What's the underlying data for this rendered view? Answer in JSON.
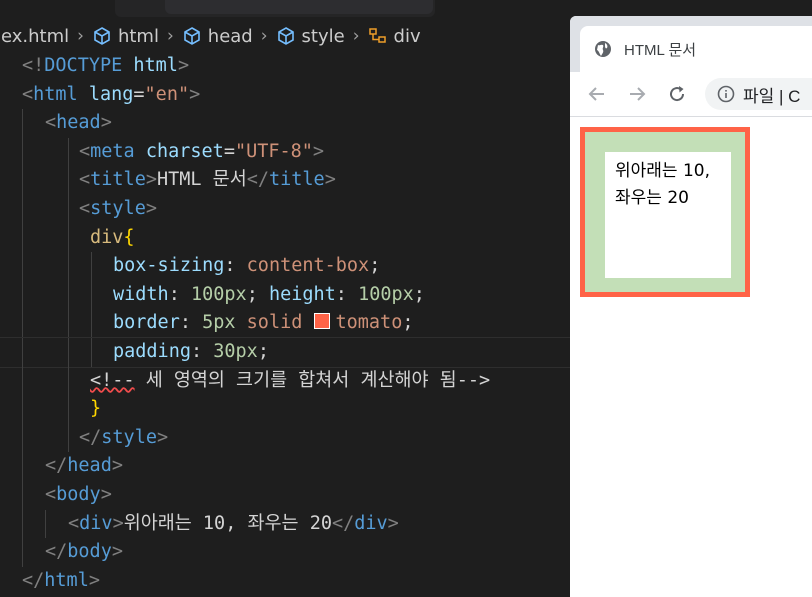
{
  "breadcrumb": {
    "items": [
      {
        "label": "lex.html",
        "icon": "file"
      },
      {
        "label": "html",
        "icon": "cube-icon"
      },
      {
        "label": "head",
        "icon": "cube-icon"
      },
      {
        "label": "style",
        "icon": "cube-icon"
      },
      {
        "label": "div",
        "icon": "css-selector-icon"
      }
    ]
  },
  "code": {
    "l1": {
      "a": "<!",
      "b": "DOCTYPE",
      "c": " html",
      "d": ">"
    },
    "l2": {
      "a": "<",
      "b": "html",
      "c": " lang",
      "d": "=",
      "e": "\"en\"",
      "f": ">"
    },
    "l3": {
      "a": "<",
      "b": "head",
      "c": ">"
    },
    "l4": {
      "a": "<",
      "b": "meta",
      "c": " charset",
      "d": "=",
      "e": "\"UTF-8\"",
      "f": ">"
    },
    "l5": {
      "a": "<",
      "b": "title",
      "c": ">",
      "d": "HTML 문서",
      "e": "</",
      "f": "title",
      "g": ">"
    },
    "l6": {
      "a": "<",
      "b": "style",
      "c": ">"
    },
    "l7": {
      "a": "div",
      "b": "{"
    },
    "l8": {
      "a": "box-sizing",
      "b": ": ",
      "c": "content-box",
      "d": ";"
    },
    "l9": {
      "a": "width",
      "b": ": ",
      "c": "100px",
      "d": "; ",
      "e": "height",
      "f": ": ",
      "g": "100px",
      "h": ";"
    },
    "l10": {
      "a": "border",
      "b": ": ",
      "c": "5px",
      "d": " solid ",
      "e": "tomato",
      "f": ";"
    },
    "l11": {
      "a": "padding",
      "b": ": ",
      "c": "30px",
      "d": ";"
    },
    "l12": {
      "a": "<!--",
      "b": " 세 영역의 크기를 합쳐서 계산해야 됨-->"
    },
    "l13": {
      "a": "}"
    },
    "l14": {
      "a": "</",
      "b": "style",
      "c": ">"
    },
    "l15": {
      "a": "</",
      "b": "head",
      "c": ">"
    },
    "l16": {
      "a": "<",
      "b": "body",
      "c": ">"
    },
    "l17": {
      "a": "<",
      "b": "div",
      "c": ">",
      "d": "위아래는 ",
      "e": "10",
      "f": ", 좌우는 ",
      "g": "20",
      "h": "</",
      "i": "div",
      "j": ">"
    },
    "l18": {
      "a": "</",
      "b": "body",
      "c": ">"
    },
    "l19": {
      "a": "</",
      "b": "html",
      "c": ">"
    }
  },
  "browser": {
    "tab_title": "HTML 문서",
    "omnibox_text": "파일  |  C",
    "page_text": "위아래는 10,\n좌우는 20"
  },
  "colors": {
    "editor_bg": "#1e1e1e",
    "tag": "#569cd6",
    "attribute": "#9cdcfe",
    "string": "#ce9178",
    "selector": "#d7ba7d",
    "number": "#b5cea8",
    "border_tomato": "#ff6347",
    "box_fill": "#c3dfb7"
  }
}
